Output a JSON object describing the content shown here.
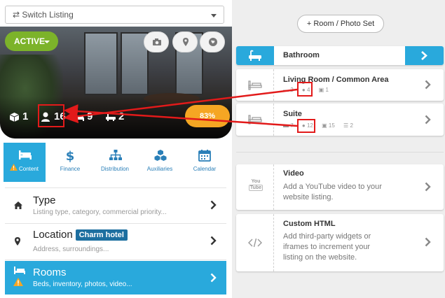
{
  "switch_listing": {
    "label": "⇄ Switch Listing"
  },
  "hero": {
    "status": "ACTIVE",
    "stats": {
      "rooms": "1",
      "guests": "16",
      "beds": "9",
      "baths": "2"
    },
    "badge": "83%"
  },
  "nav": [
    {
      "label": "Content",
      "icon": "bed-icon",
      "active": true
    },
    {
      "label": "Finance",
      "icon": "dollar-icon"
    },
    {
      "label": "Distribution",
      "icon": "sitemap-icon"
    },
    {
      "label": "Auxiliaries",
      "icon": "cubes-icon"
    },
    {
      "label": "Calendar",
      "icon": "calendar-icon"
    }
  ],
  "sections": {
    "type": {
      "title": "Type",
      "subtitle": "Listing type, category, commercial priority..."
    },
    "location": {
      "title": "Location",
      "badge": "Charm hotel",
      "subtitle": "Address, surroundings..."
    },
    "rooms": {
      "title": "Rooms",
      "subtitle": "Beds, inventory, photos, video..."
    }
  },
  "add_set_button": "+ Room / Photo Set",
  "room_cards": [
    {
      "title": "Bathroom"
    },
    {
      "title": "Living Room / Common Area",
      "beds": "2",
      "guests": "4",
      "photos": "1"
    },
    {
      "title": "Suite",
      "beds": "7",
      "guests": "12",
      "photos": "15",
      "list": "2"
    }
  ],
  "extra_cards": {
    "video": {
      "title": "Video",
      "description": "Add a YouTube video to your website listing.",
      "logo_top": "You",
      "logo_bottom": "Tube"
    },
    "html": {
      "title": "Custom HTML",
      "description": "Add third-party widgets or iframes to increment your listing on the website."
    }
  },
  "colors": {
    "accent": "#29a9dc",
    "active_green": "#7cb32a",
    "badge_orange": "#f5a623",
    "annotation_red": "#e21a1a",
    "warning": "#f5a623"
  }
}
